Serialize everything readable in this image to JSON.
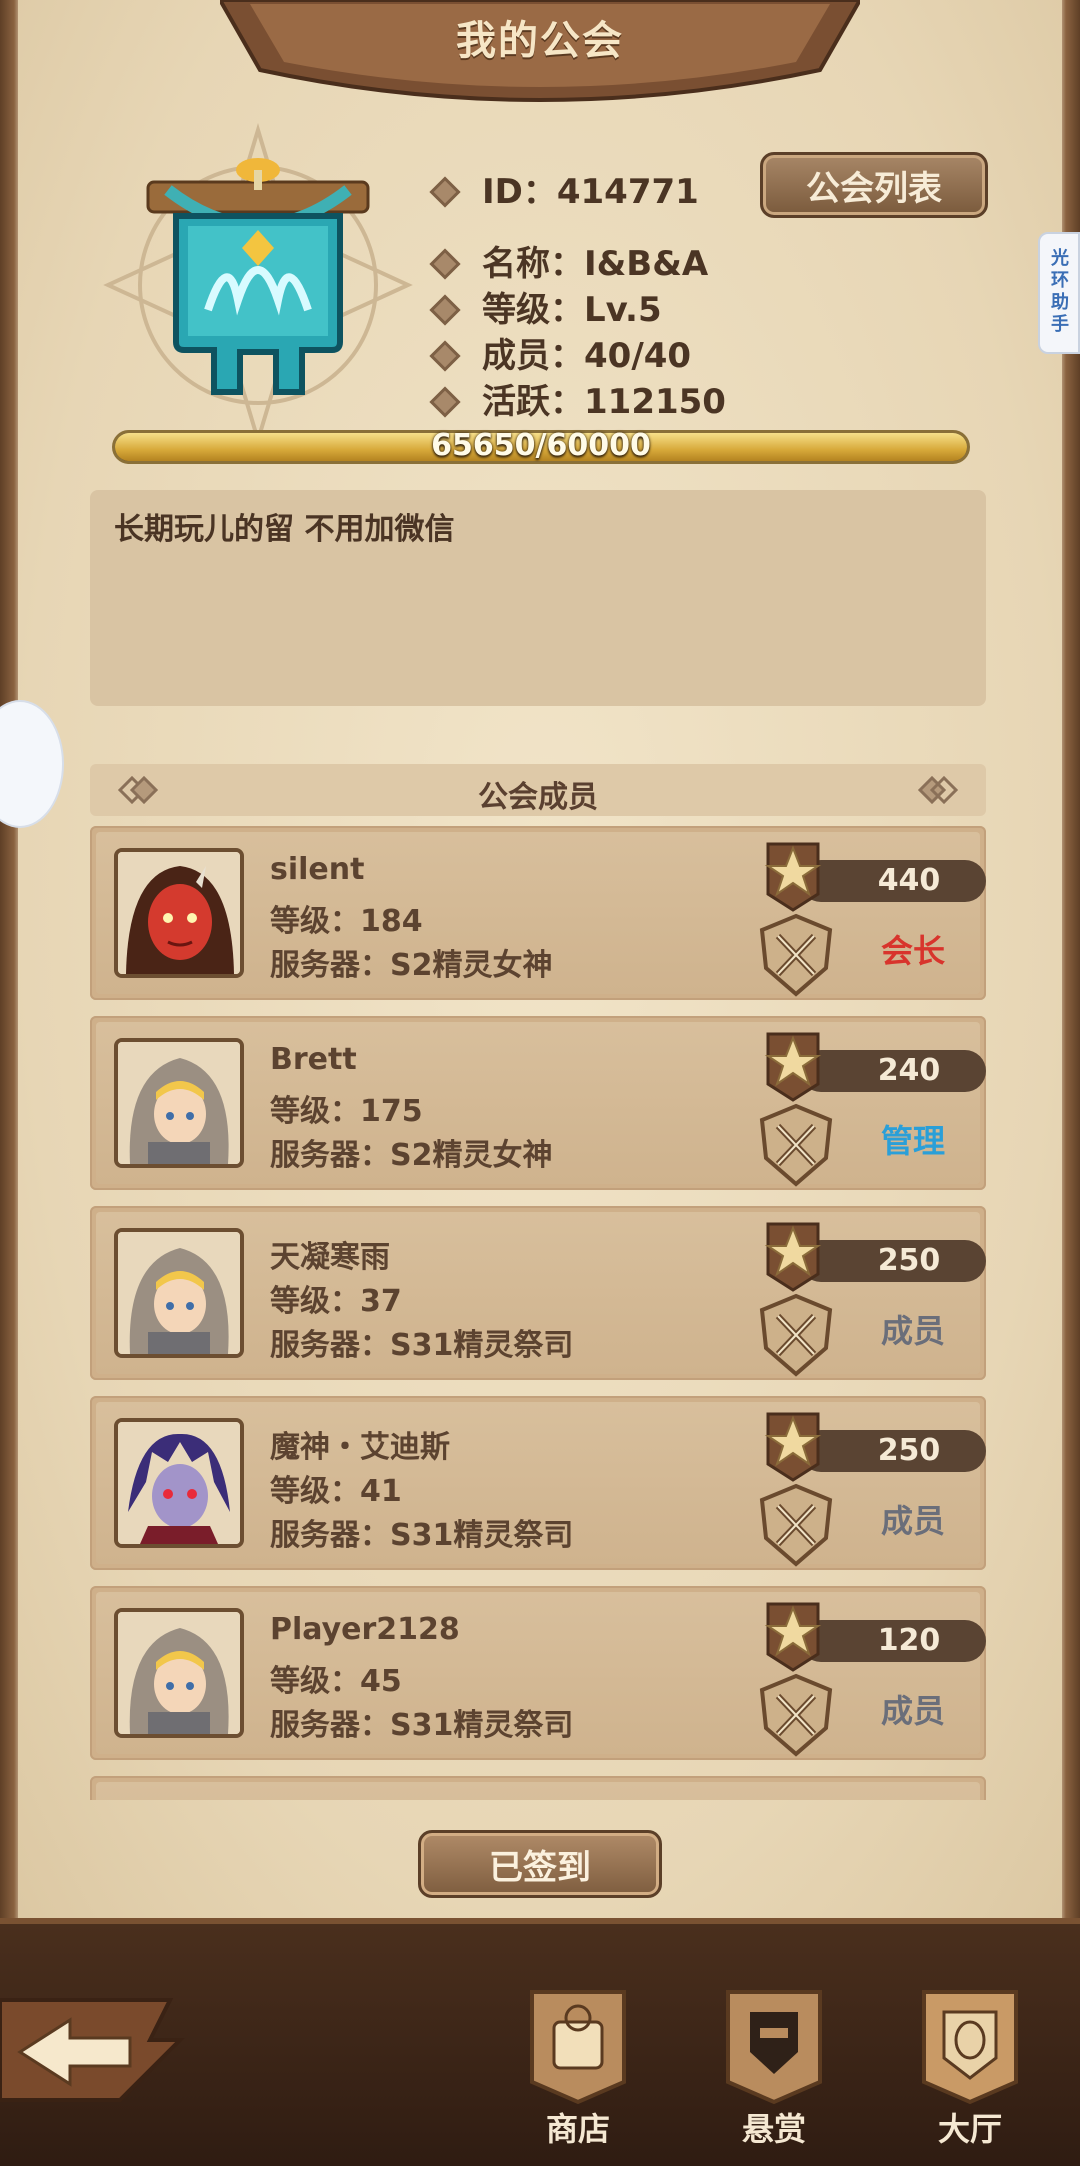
{
  "header": {
    "title": "我的公会"
  },
  "guild": {
    "id": "ID：414771",
    "name": "名称：I&B&A",
    "level": "等级：Lv.5",
    "members": "成员：40/40",
    "activity": "活跃：112150",
    "list_button": "公会列表",
    "progress_text": "65650/60000",
    "progress_fraction": 1.0,
    "notice": "长期玩儿的留 不用加微信"
  },
  "members_section": {
    "title": "公会成员"
  },
  "members": [
    {
      "name": "silent",
      "level": "等级：184",
      "server": "服务器：S2精灵女神",
      "points": "440",
      "role": "会长",
      "role_type": "leader",
      "avatar": "red-demon"
    },
    {
      "name": "Brett",
      "level": "等级：175",
      "server": "服务器：S2精灵女神",
      "points": "240",
      "role": "管理",
      "role_type": "admin",
      "avatar": "hooded"
    },
    {
      "name": "天凝寒雨",
      "level": "等级：37",
      "server": "服务器：S31精灵祭司",
      "points": "250",
      "role": "成员",
      "role_type": "member",
      "avatar": "hooded"
    },
    {
      "name": "魔神・艾迪斯",
      "level": "等级：41",
      "server": "服务器：S31精灵祭司",
      "points": "250",
      "role": "成员",
      "role_type": "member",
      "avatar": "purple-demon"
    },
    {
      "name": "Player2128",
      "level": "等级：45",
      "server": "服务器：S31精灵祭司",
      "points": "120",
      "role": "成员",
      "role_type": "member",
      "avatar": "hooded"
    }
  ],
  "actions": {
    "sign_in": "已签到"
  },
  "nav": [
    {
      "label": "商店",
      "icon": "shop-icon"
    },
    {
      "label": "悬赏",
      "icon": "bounty-icon"
    },
    {
      "label": "大厅",
      "icon": "hall-icon"
    }
  ],
  "overlay": {
    "side_tab": "光环助手"
  },
  "colors": {
    "leader": "#d8342c",
    "admin": "#2a9fd8",
    "member": "#6a6e7a",
    "progress": "#d7a93a"
  }
}
